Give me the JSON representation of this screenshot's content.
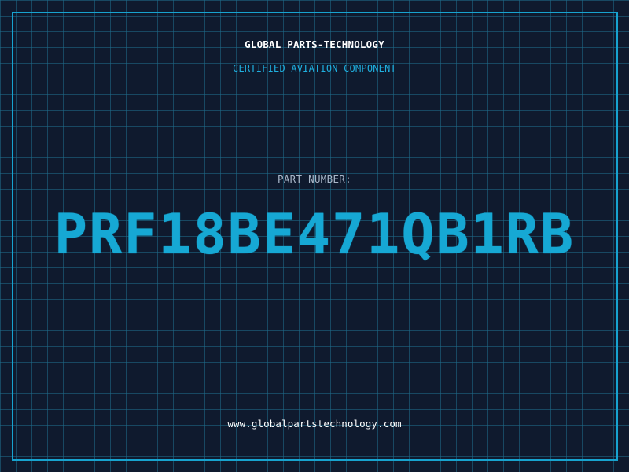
{
  "header": {
    "company": "GLOBAL PARTS-TECHNOLOGY",
    "tagline": "CERTIFIED AVIATION COMPONENT"
  },
  "part": {
    "label": "PART NUMBER:",
    "number": "PRF18BE471QB1RB"
  },
  "footer": {
    "website": "www.globalpartstechnology.com"
  },
  "colors": {
    "background": "#0f1a2e",
    "grid": "#1e6e8c",
    "accent": "#17a3cf",
    "text": "#ffffff",
    "muted": "#a9b7c9"
  }
}
